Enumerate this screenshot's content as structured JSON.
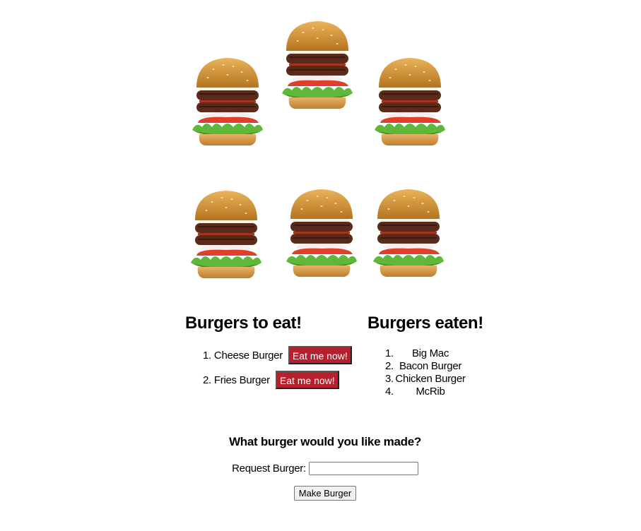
{
  "hero": {
    "alt": "burgers"
  },
  "to_eat": {
    "title": "Burgers to eat!",
    "items": [
      {
        "num": "1.",
        "name": "Cheese Burger",
        "button": "Eat me now!"
      },
      {
        "num": "2.",
        "name": "Fries Burger",
        "button": "Eat me now!"
      }
    ]
  },
  "eaten": {
    "title": "Burgers eaten!",
    "items": [
      {
        "num": "1.",
        "name": "Big Mac"
      },
      {
        "num": "2.",
        "name": "Bacon Burger"
      },
      {
        "num": "3.",
        "name": "Chicken Burger"
      },
      {
        "num": "4.",
        "name": "McRib"
      }
    ]
  },
  "form": {
    "title": "What burger would you like made?",
    "label": "Request Burger:",
    "value": "",
    "submit": "Make Burger"
  },
  "colors": {
    "eat_button_bg": "#b5202c",
    "bun": "#d99a3a",
    "patty": "#5a2a1a",
    "lettuce": "#5fb83a",
    "tomato": "#e0402a"
  }
}
